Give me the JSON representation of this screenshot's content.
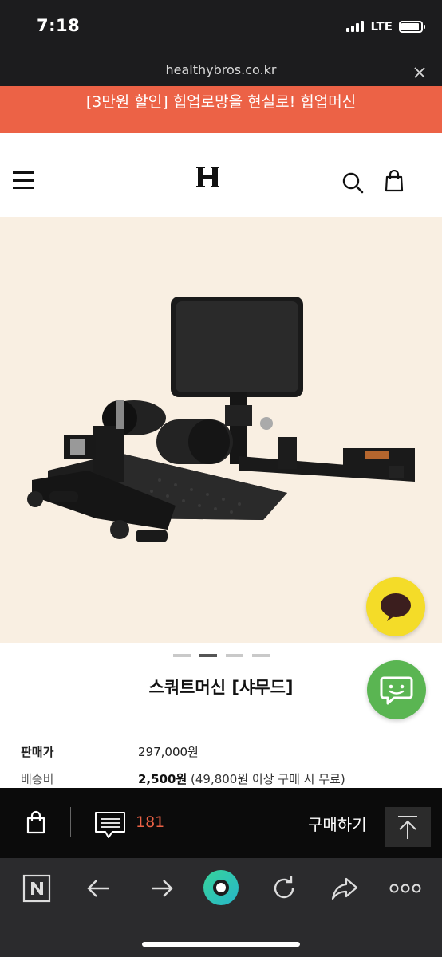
{
  "status_bar": {
    "time": "7:18",
    "network": "LTE",
    "battery_level": 0.9
  },
  "browser": {
    "url": "healthybros.co.kr"
  },
  "promo_banner": {
    "text": "[3만원 할인] 힙업로망을 현실로! 힙업머신"
  },
  "header": {
    "logo": "H"
  },
  "carousel": {
    "total": 4,
    "active_index": 1
  },
  "product": {
    "title": "스쿼트머신 [샤무드]",
    "price_label": "판매가",
    "price_value": "297,000원",
    "shipping_label": "배송비",
    "shipping_fee": "2,500원",
    "shipping_note": " (49,800원 이상 구매 시 무료)"
  },
  "action_bar": {
    "review_count": "181",
    "buy_label": "구매하기"
  },
  "colors": {
    "accent": "#ec6246",
    "hero_bg": "#f9efe2",
    "kakao": "#f4dc28",
    "chat": "#5ab552"
  },
  "icons": {
    "header": [
      "menu-icon",
      "search-icon",
      "shopping-bag-icon"
    ],
    "toolbar": [
      "naver-icon",
      "back-arrow-icon",
      "forward-arrow-icon",
      "home-green-icon",
      "refresh-icon",
      "share-icon",
      "more-icon"
    ]
  }
}
